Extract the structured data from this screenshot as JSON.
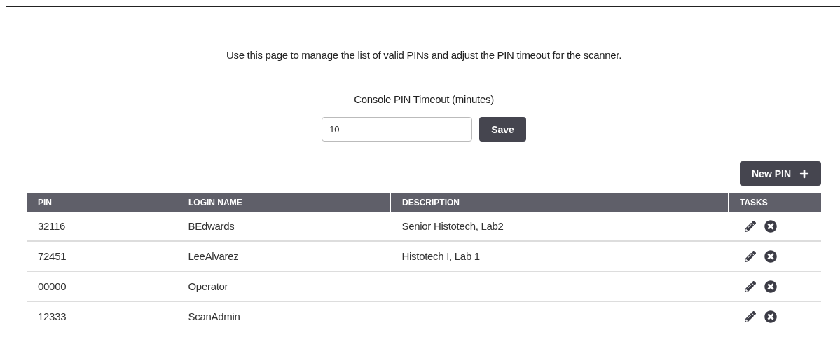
{
  "intro": "Use this page to manage the list of valid PINs and adjust the PIN timeout for the scanner.",
  "timeout": {
    "label": "Console PIN Timeout (minutes)",
    "value": "10",
    "save_button": "Save"
  },
  "new_pin_button": "New PIN",
  "table": {
    "columns": [
      "PIN",
      "LOGIN NAME",
      "DESCRIPTION",
      "TASKS"
    ],
    "rows": [
      {
        "pin": "32116",
        "login_name": "BEdwards",
        "description": "Senior Histotech, Lab2"
      },
      {
        "pin": "72451",
        "login_name": "LeeAlvarez",
        "description": "Histotech I, Lab 1"
      },
      {
        "pin": "00000",
        "login_name": "Operator"
      },
      {
        "pin": "12333",
        "login_name": "ScanAdmin"
      }
    ]
  }
}
